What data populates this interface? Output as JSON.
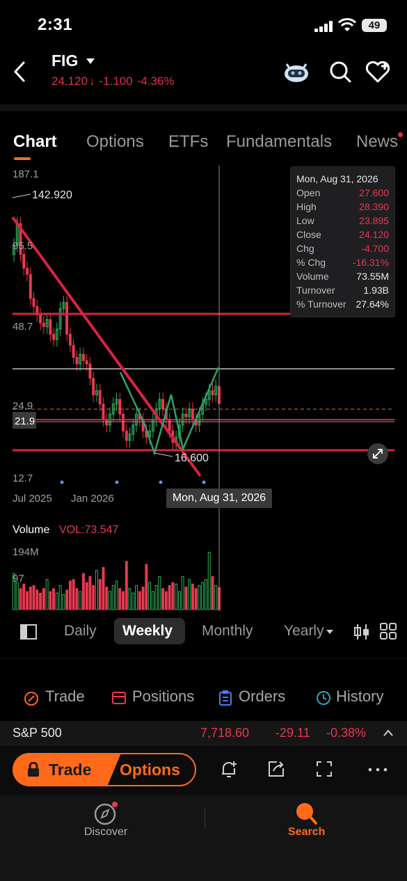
{
  "status": {
    "time": "2:31",
    "battery": "49"
  },
  "header": {
    "ticker": "FIG",
    "price": "24.120",
    "change": "-1.100",
    "change_pct": "-4.36%"
  },
  "tabs": [
    {
      "label": "Chart",
      "active": true
    },
    {
      "label": "Options"
    },
    {
      "label": "ETFs"
    },
    {
      "label": "Fundamentals"
    },
    {
      "label": "News"
    }
  ],
  "chart": {
    "y_ticks": [
      "187.1",
      "95.5",
      "48.7",
      "24.9",
      "21.9",
      "12.7"
    ],
    "x_ticks": [
      "Jul 2025",
      "Jan 2026"
    ],
    "high_marker": "142.920",
    "low_marker": "16.600",
    "crosshair_date": "Mon, Aug 31, 2026",
    "colors": {
      "up": "#2fb35f",
      "down": "#e8384f",
      "trendline": "#d9233f"
    }
  },
  "tooltip": {
    "title": "Mon, Aug 31, 2026",
    "rows": [
      {
        "label": "Open",
        "value": "27.600"
      },
      {
        "label": "High",
        "value": "28.390"
      },
      {
        "label": "Low",
        "value": "23.895"
      },
      {
        "label": "Close",
        "value": "24.120"
      },
      {
        "label": "Chg",
        "value": "-4.700"
      },
      {
        "label": "% Chg",
        "value": "-16.31%"
      },
      {
        "label": "Volume",
        "value": "73.55M"
      },
      {
        "label": "Turnover",
        "value": "1.93B"
      },
      {
        "label": "% Turnover",
        "value": "27.64%"
      }
    ]
  },
  "volume": {
    "label": "Volume",
    "value": "VOL:73.547",
    "ticks": [
      "194M",
      "97"
    ]
  },
  "periods": [
    "Daily",
    "Weekly",
    "Monthly",
    "Yearly"
  ],
  "tradebar": [
    "Trade",
    "Positions",
    "Orders",
    "History"
  ],
  "index_row": {
    "name": "S&P 500",
    "value": "7,718.60",
    "change": "-29.11",
    "change_pct": "-0.38%"
  },
  "actions": {
    "trade": "Trade",
    "options": "Options"
  },
  "nav": {
    "discover": "Discover",
    "search": "Search"
  },
  "chart_data": {
    "type": "candlestick",
    "title": "",
    "xlabel": "",
    "ylabel": "",
    "scale": "log",
    "ylim": [
      12.7,
      187.1
    ],
    "x_ticks": [
      "Jul 2025",
      "Jan 2026"
    ],
    "horizontal_levels": [
      48.7,
      21.9,
      16.6
    ],
    "last_bar": {
      "date": "Mon, Aug 31, 2026",
      "open": 27.6,
      "high": 28.39,
      "low": 23.895,
      "close": 24.12
    },
    "closes": [
      95.5,
      115,
      88,
      78,
      74,
      60,
      56,
      52,
      48.5,
      47,
      50,
      44,
      42,
      46,
      55,
      58,
      44,
      40,
      36,
      34,
      37,
      35,
      34,
      30,
      26,
      27,
      24,
      21,
      20,
      22,
      24,
      25,
      22,
      19,
      17.5,
      18.5,
      20,
      22,
      21,
      19,
      18,
      19,
      21,
      23,
      25,
      23,
      21,
      19,
      17.2,
      18,
      20,
      22,
      21.5,
      23,
      21,
      20,
      22,
      24,
      25,
      27,
      26,
      28,
      24.12
    ],
    "volumes": [
      120,
      90,
      70,
      85,
      60,
      75,
      80,
      65,
      55,
      70,
      100,
      60,
      70,
      55,
      80,
      50,
      65,
      95,
      100,
      70,
      60,
      120,
      90,
      110,
      80,
      130,
      100,
      140,
      75,
      60,
      80,
      95,
      70,
      60,
      160,
      70,
      55,
      80,
      60,
      75,
      150,
      90,
      60,
      80,
      110,
      70,
      60,
      80,
      90,
      85,
      60,
      110,
      75,
      100,
      85,
      70,
      80,
      90,
      100,
      190,
      110,
      80,
      73.547
    ]
  }
}
